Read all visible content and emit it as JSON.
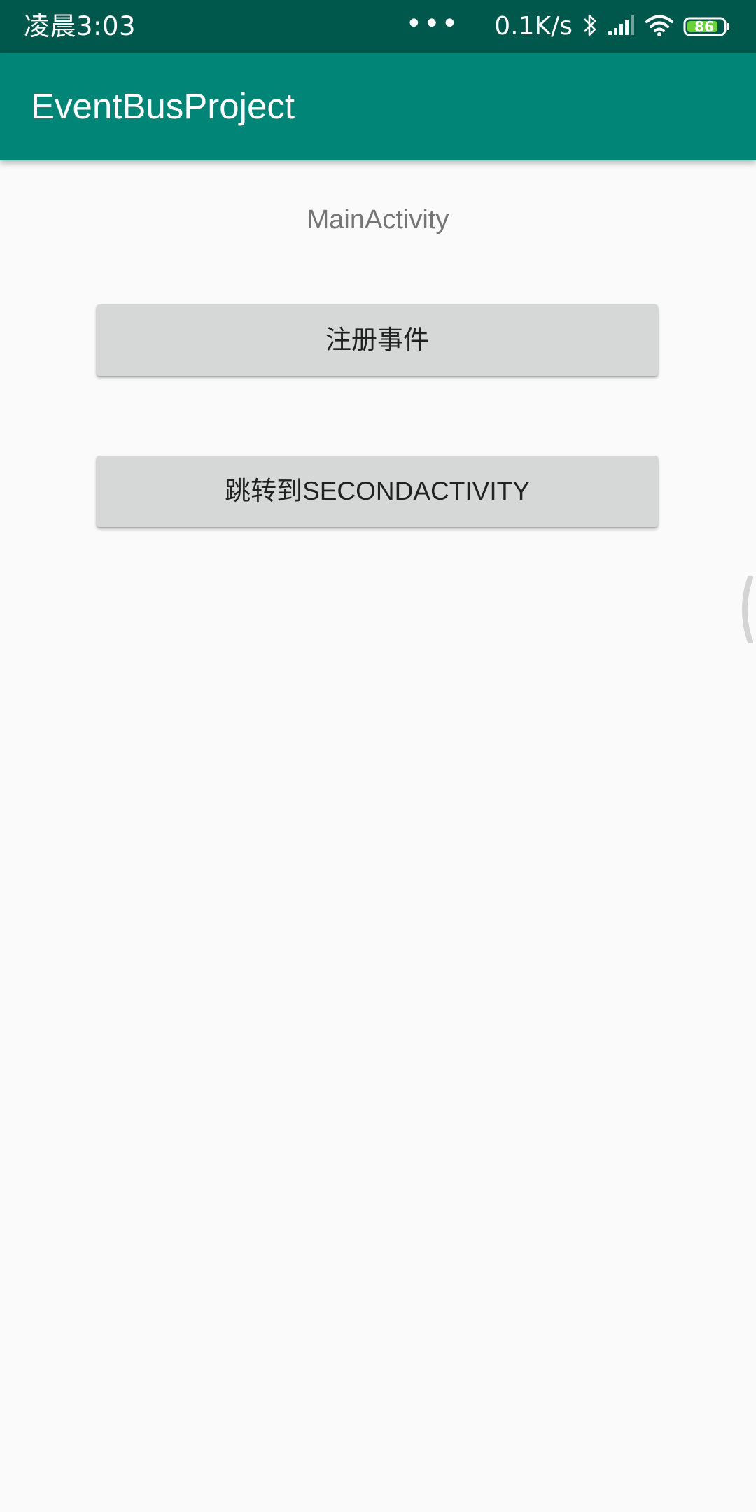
{
  "status_bar": {
    "time": "凌晨3:03",
    "dots": "•••",
    "net_speed": "0.1K/s",
    "battery_level": "86",
    "icons": [
      "bluetooth-icon",
      "signal-icon",
      "wifi-icon",
      "battery-icon"
    ]
  },
  "app_bar": {
    "title": "EventBusProject"
  },
  "main": {
    "label": "MainActivity",
    "register_button": "注册事件",
    "jump_button": "跳转到SECONDACTIVITY"
  },
  "colors": {
    "status_bar": "#00574b",
    "app_bar": "#008577",
    "background": "#fafafa",
    "button": "#d6d7d7"
  }
}
